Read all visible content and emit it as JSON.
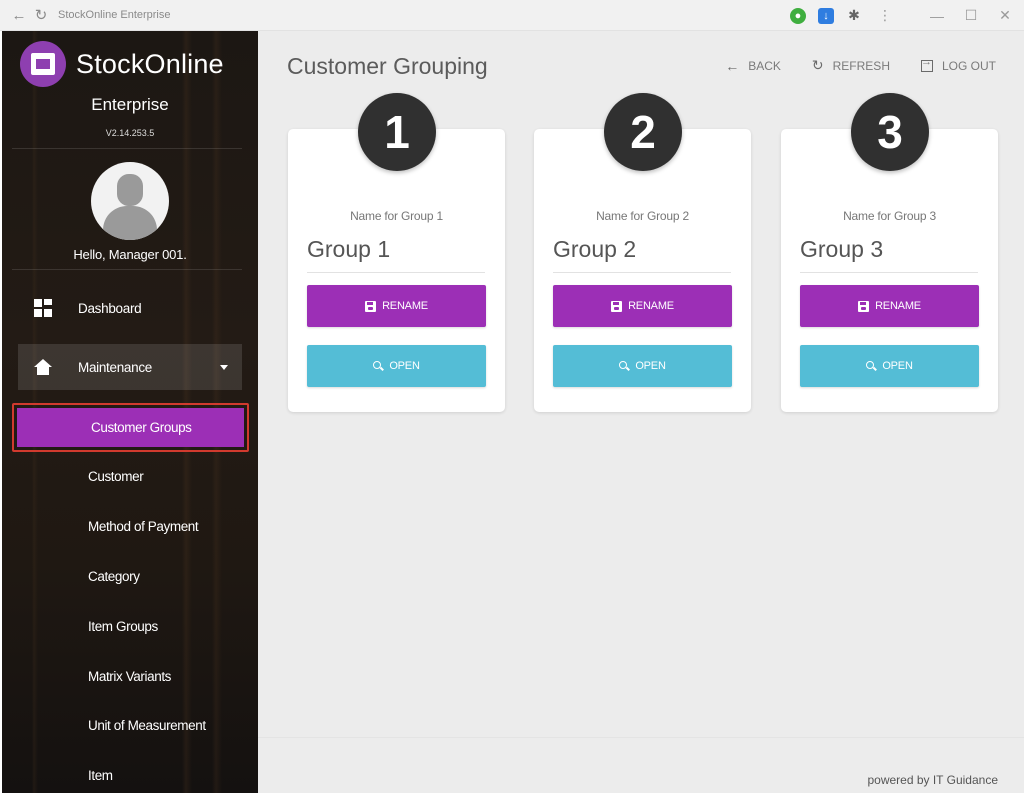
{
  "browser": {
    "back_icon": "arrow-left-icon",
    "reload_icon": "reload-icon",
    "title": "StockOnline Enterprise",
    "extensions": [
      "green-circle-icon",
      "download-icon",
      "puzzle-icon"
    ],
    "menu_icon": "kebab-menu-icon",
    "window_controls": [
      "minimize-icon",
      "maximize-icon",
      "close-icon"
    ]
  },
  "sidebar": {
    "brand": "StockOnline",
    "subtitle": "Enterprise",
    "version": "V2.14.253.5",
    "greeting": "Hello, Manager 001.",
    "menu": [
      {
        "label": "Dashboard",
        "icon": "dashboard-icon"
      },
      {
        "label": "Maintenance",
        "icon": "home-icon"
      }
    ],
    "submenu": [
      {
        "label": "Customer Groups",
        "active": true
      },
      {
        "label": "Customer"
      },
      {
        "label": "Method of Payment"
      },
      {
        "label": "Category"
      },
      {
        "label": "Item Groups"
      },
      {
        "label": "Matrix Variants"
      },
      {
        "label": "Unit of Measurement"
      },
      {
        "label": "Item"
      }
    ]
  },
  "header": {
    "title": "Customer Grouping",
    "back": "BACK",
    "refresh": "REFRESH",
    "logout": "LOG OUT"
  },
  "cards": [
    {
      "number": "1",
      "label": "Name for Group 1",
      "value": "Group 1",
      "rename": "RENAME",
      "open": "OPEN"
    },
    {
      "number": "2",
      "label": "Name for Group 2",
      "value": "Group 2",
      "rename": "RENAME",
      "open": "OPEN"
    },
    {
      "number": "3",
      "label": "Name for Group 3",
      "value": "Group 3",
      "rename": "RENAME",
      "open": "OPEN"
    }
  ],
  "footer": {
    "text": "powered by IT Guidance"
  },
  "colors": {
    "accent": "#9c2fb6",
    "open_button": "#54bdd6",
    "highlight_border": "#d13a2e"
  }
}
